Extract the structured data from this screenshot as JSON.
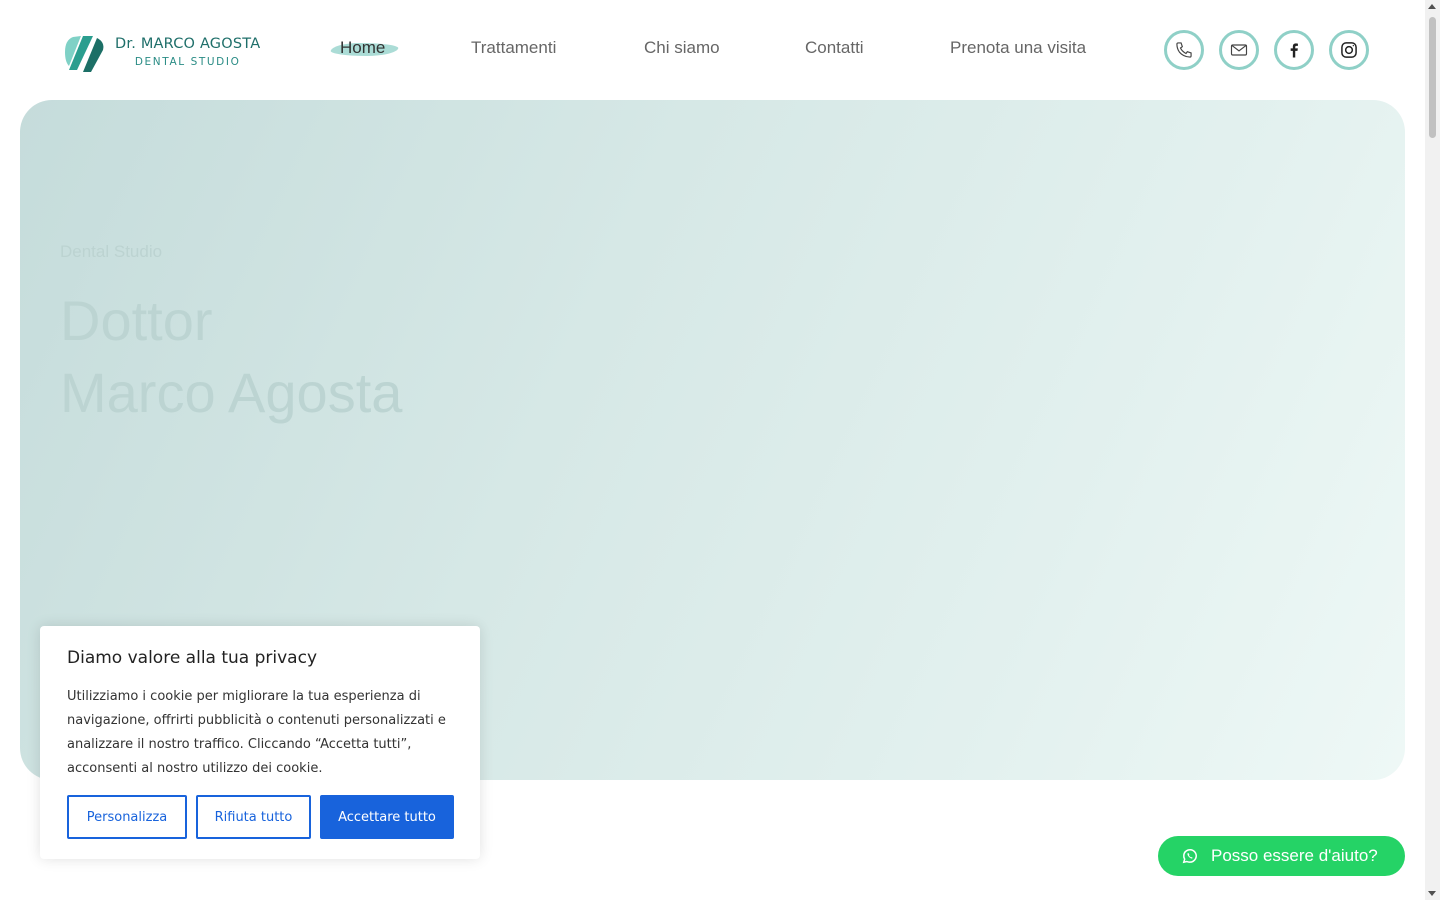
{
  "header": {
    "logo": {
      "name": "Dr. MARCO AGOSTA",
      "subtitle": "DENTAL STUDIO"
    },
    "nav": [
      {
        "label": "Home",
        "active": true
      },
      {
        "label": "Trattamenti",
        "active": false
      },
      {
        "label": "Chi siamo",
        "active": false
      },
      {
        "label": "Contatti",
        "active": false
      },
      {
        "label": "Prenota una visita",
        "active": false
      }
    ],
    "social_icons": [
      "phone-icon",
      "mail-icon",
      "facebook-icon",
      "instagram-icon"
    ]
  },
  "hero": {
    "kicker": "Dental Studio",
    "title_line1": "Dottor",
    "title_line2": "Marco Agosta"
  },
  "cookie": {
    "title": "Diamo valore alla tua privacy",
    "text": "Utilizziamo i cookie per migliorare la tua esperienza di navigazione, offrirti pubblicità o contenuti personalizzati e analizzare il nostro traffico. Cliccando “Accetta tutti”, acconsenti al nostro utilizzo dei cookie.",
    "customize_label": "Personalizza",
    "reject_label": "Rifiuta tutto",
    "accept_label": "Accettare tutto"
  },
  "whatsapp": {
    "label": "Posso essere d'aiuto?"
  },
  "colors": {
    "brand_teal": "#1f6f6a",
    "accent_mint": "#8fd0c7",
    "cookie_blue": "#1863dc",
    "whatsapp_green": "#25d366"
  }
}
